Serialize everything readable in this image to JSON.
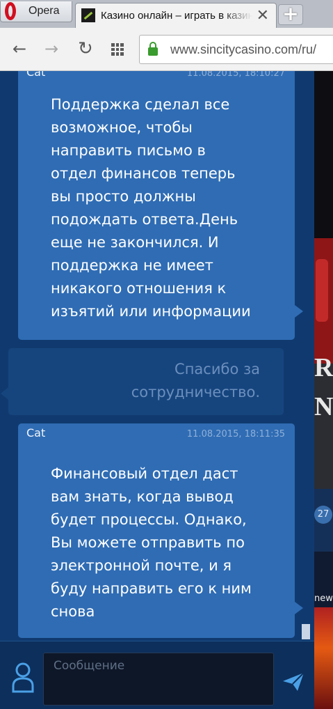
{
  "browser": {
    "opera_label": "Opera",
    "tab_title": "Казино онлайн – играть в казино",
    "tab_close": "✕",
    "new_tab": "+",
    "url": "www.sincitycasino.com/ru/"
  },
  "chat": {
    "messages": [
      {
        "role": "agent",
        "author": "Cat",
        "time": "11.08.2015, 18:10:27",
        "lines": [
          "Поддержка сделал все",
          "возможное, чтобы",
          "направить письмо в",
          "отдел финансов теперь",
          "вы просто должны",
          "подождать ответа.День",
          "еще не закончился. И",
          "поддержка не имеет",
          "никакого отношения к",
          "изъятий или информации"
        ]
      },
      {
        "role": "user",
        "lines": [
          "Спасибо за",
          "сотрудничество."
        ]
      },
      {
        "role": "agent",
        "author": "Cat",
        "time": "11.08.2015, 18:11:35",
        "lines": [
          "Финансовый отдел даст",
          "вам знать, когда вывод",
          "будет процессы. Однако,",
          "Вы можете отправить по",
          "электронной почте, и я",
          "буду направить его к ним",
          "снова"
        ]
      }
    ],
    "input_placeholder": "Сообщение"
  },
  "sidebar": {
    "letters": "RA\nN",
    "badge": "27",
    "new_label": "new"
  },
  "colors": {
    "chat_bg": "#103a6f",
    "agent_bubble": "#2f6cb4",
    "user_bubble": "#16457e",
    "accent": "#4aa0e6"
  }
}
